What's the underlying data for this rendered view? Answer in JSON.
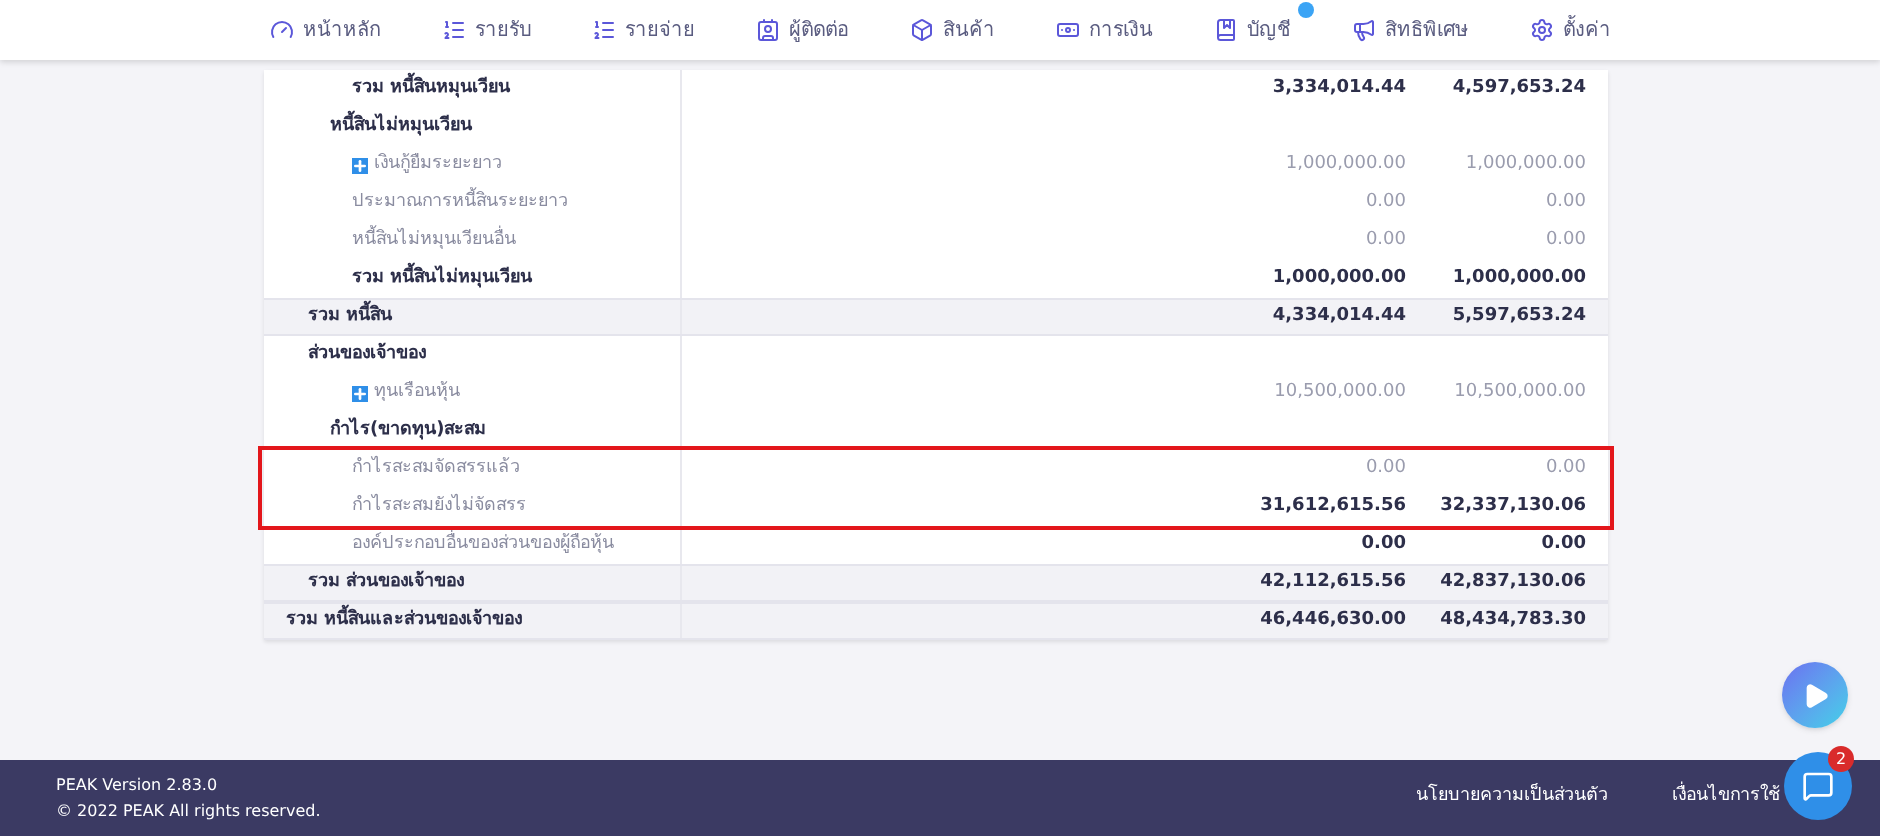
{
  "nav": [
    {
      "label": "หน้าหลัก",
      "badge": false
    },
    {
      "label": "รายรับ",
      "badge": false
    },
    {
      "label": "รายจ่าย",
      "badge": false
    },
    {
      "label": "ผู้ติดต่อ",
      "badge": false
    },
    {
      "label": "สินค้า",
      "badge": false
    },
    {
      "label": "การเงิน",
      "badge": false
    },
    {
      "label": "บัญชี",
      "badge": true
    },
    {
      "label": "สิทธิพิเศษ",
      "badge": false
    },
    {
      "label": "ตั้งค่า",
      "badge": false
    }
  ],
  "table": {
    "rows": [
      {
        "kind": "subtotal",
        "label": "รวม หนี้สินหมุนเวียน",
        "values": [
          "3,334,014.44",
          "4,597,653.24"
        ]
      },
      {
        "kind": "group",
        "label": "หนี้สินไม่หมุนเวียน"
      },
      {
        "kind": "item",
        "label": "เงินกู้ยืมระยะยาว",
        "expandable": true,
        "values": [
          "1,000,000.00",
          "1,000,000.00"
        ]
      },
      {
        "kind": "item",
        "label": "ประมาณการหนี้สินระยะยาว",
        "values": [
          "0.00",
          "0.00"
        ]
      },
      {
        "kind": "item",
        "label": "หนี้สินไม่หมุนเวียนอื่น",
        "values": [
          "0.00",
          "0.00"
        ]
      },
      {
        "kind": "subtotal",
        "label": "รวม หนี้สินไม่หมุนเวียน",
        "values": [
          "1,000,000.00",
          "1,000,000.00"
        ]
      },
      {
        "kind": "total",
        "label": "รวม หนี้สิน",
        "values": [
          "4,334,014.44",
          "5,597,653.24"
        ]
      },
      {
        "kind": "section",
        "label": "ส่วนของเจ้าของ"
      },
      {
        "kind": "item",
        "label": "ทุนเรือนหุ้น",
        "expandable": true,
        "values": [
          "10,500,000.00",
          "10,500,000.00"
        ]
      },
      {
        "kind": "group",
        "label": "กำไร(ขาดทุน)สะสม"
      },
      {
        "kind": "item",
        "label": "กำไรสะสมจัดสรรแล้ว",
        "highlighted": true,
        "values": [
          "0.00",
          "0.00"
        ]
      },
      {
        "kind": "item",
        "label": "กำไรสะสมยังไม่จัดสรร",
        "highlighted": true,
        "bold_values": true,
        "values": [
          "31,612,615.56",
          "32,337,130.06"
        ]
      },
      {
        "kind": "item",
        "label": "องค์ประกอบอื่นของส่วนของผู้ถือหุ้น",
        "bold_values": true,
        "values": [
          "0.00",
          "0.00"
        ]
      },
      {
        "kind": "total",
        "label": "รวม ส่วนของเจ้าของ",
        "values": [
          "42,112,615.56",
          "42,837,130.06"
        ]
      },
      {
        "kind": "grand_total",
        "label": "รวม หนี้สินและส่วนของเจ้าของ",
        "values": [
          "46,446,630.00",
          "48,434,783.30"
        ]
      }
    ]
  },
  "footer": {
    "version": "PEAK Version 2.83.0",
    "copyright": "© 2022 PEAK All rights reserved.",
    "links": [
      "นโยบายความเป็นส่วนตัว",
      "เงื่อนไขการใช้"
    ]
  },
  "chat": {
    "badge": "2"
  }
}
